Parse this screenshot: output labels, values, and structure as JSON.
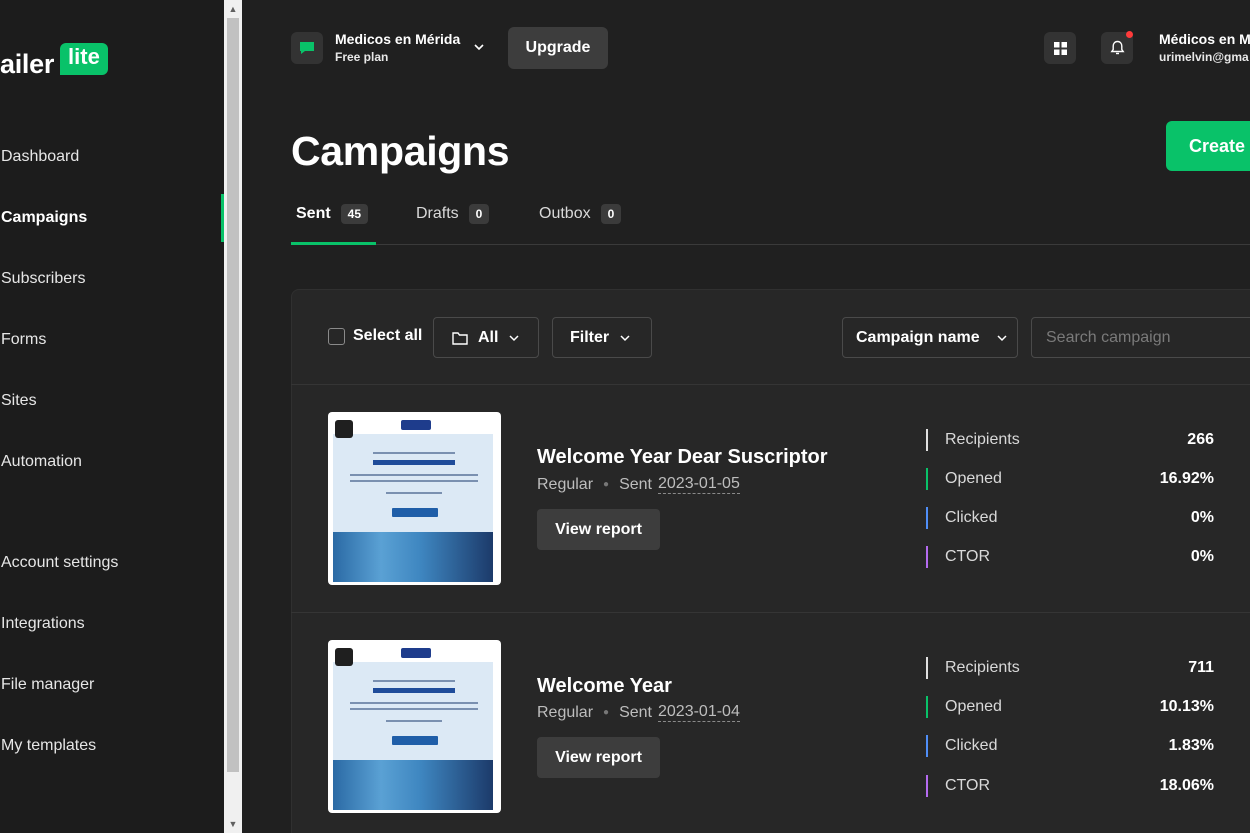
{
  "sidebar": {
    "logo_text": "ailer",
    "logo_badge": "lite",
    "items": [
      {
        "label": "Dashboard"
      },
      {
        "label": "Campaigns"
      },
      {
        "label": "Subscribers"
      },
      {
        "label": "Forms"
      },
      {
        "label": "Sites"
      },
      {
        "label": "Automation"
      },
      {
        "label": "Account settings"
      },
      {
        "label": "Integrations"
      },
      {
        "label": "File manager"
      },
      {
        "label": "My templates"
      }
    ],
    "active_item": "Campaigns"
  },
  "header": {
    "workspace_name": "Medicos en Mérida",
    "workspace_plan": "Free plan",
    "upgrade_label": "Upgrade",
    "user_name": "Médicos en M",
    "user_email": "urimelvin@gma"
  },
  "page": {
    "title": "Campaigns",
    "create_label": "Create"
  },
  "tabs": [
    {
      "label": "Sent",
      "count": "45"
    },
    {
      "label": "Drafts",
      "count": "0"
    },
    {
      "label": "Outbox",
      "count": "0"
    }
  ],
  "toolbar": {
    "select_all": "Select all",
    "folder_label": "All",
    "filter_label": "Filter",
    "sort_label": "Campaign name",
    "search_placeholder": "Search campaign"
  },
  "campaigns": [
    {
      "title": "Welcome Year Dear Suscriptor",
      "type": "Regular",
      "sent_label": "Sent",
      "date": "2023-01-05",
      "report_label": "View report",
      "stats": [
        {
          "label": "Recipients",
          "value": "266"
        },
        {
          "label": "Opened",
          "value": "16.92%"
        },
        {
          "label": "Clicked",
          "value": "0%"
        },
        {
          "label": "CTOR",
          "value": "0%"
        }
      ]
    },
    {
      "title": "Welcome Year",
      "type": "Regular",
      "sent_label": "Sent",
      "date": "2023-01-04",
      "report_label": "View report",
      "stats": [
        {
          "label": "Recipients",
          "value": "711"
        },
        {
          "label": "Opened",
          "value": "10.13%"
        },
        {
          "label": "Clicked",
          "value": "1.83%"
        },
        {
          "label": "CTOR",
          "value": "18.06%"
        }
      ]
    }
  ],
  "colors": {
    "accent": "#09c269",
    "recipients_bar": "#e0e0e0",
    "opened_bar": "#09c269",
    "clicked_bar": "#4f8ef7",
    "ctor_bar": "#b46bf0"
  }
}
